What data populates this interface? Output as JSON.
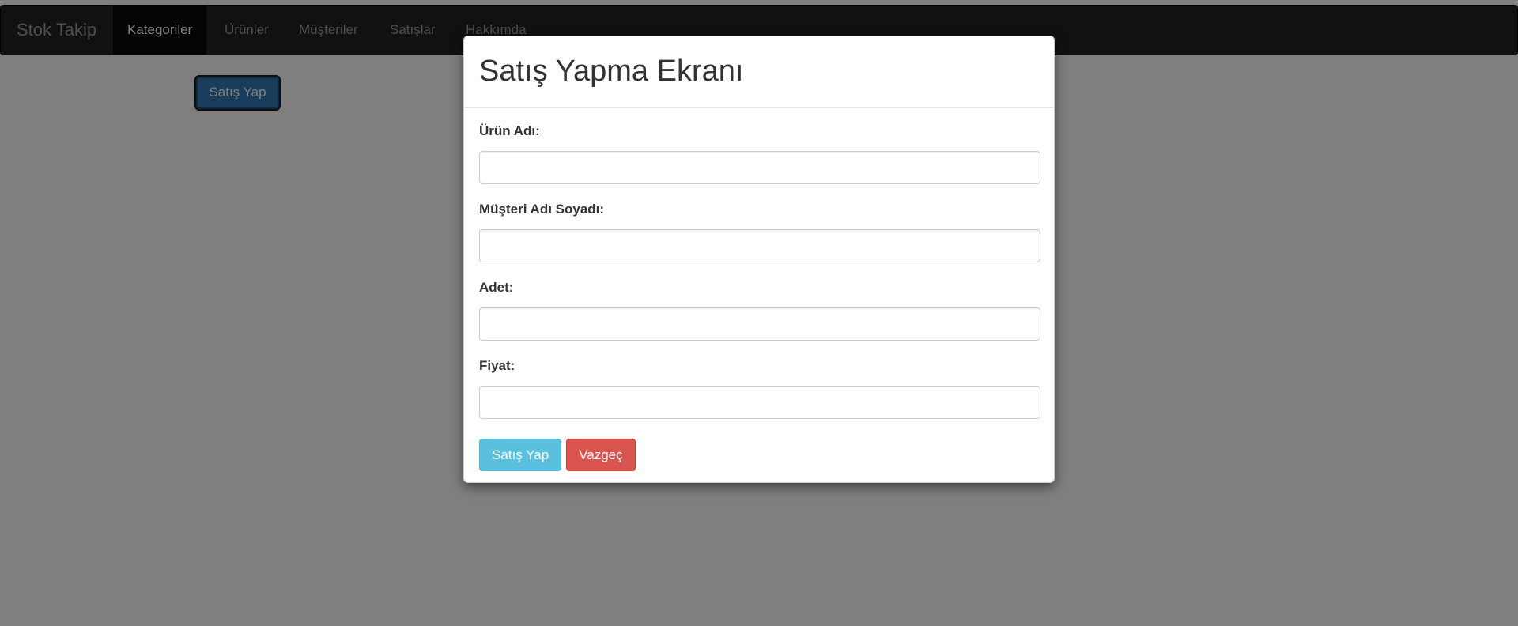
{
  "navbar": {
    "brand": "Stok Takip",
    "items": [
      {
        "label": "Kategoriler",
        "active": true
      },
      {
        "label": "Ürünler",
        "active": false
      },
      {
        "label": "Müşteriler",
        "active": false
      },
      {
        "label": "Satışlar",
        "active": false
      },
      {
        "label": "Hakkımda",
        "active": false
      }
    ]
  },
  "page": {
    "open_modal_button": "Satış Yap"
  },
  "modal": {
    "title": "Satış Yapma Ekranı",
    "fields": [
      {
        "label": "Ürün Adı:",
        "value": "",
        "placeholder": ""
      },
      {
        "label": "Müşteri Adı Soyadı:",
        "value": "",
        "placeholder": ""
      },
      {
        "label": "Adet:",
        "value": "",
        "placeholder": ""
      },
      {
        "label": "Fiyat:",
        "value": "",
        "placeholder": ""
      }
    ],
    "submit_label": "Satış Yap",
    "cancel_label": "Vazgeç"
  },
  "colors": {
    "navbar_bg": "#222222",
    "primary": "#337ab7",
    "info": "#5bc0de",
    "danger": "#d9534f",
    "backdrop": "rgba(0,0,0,0.5)"
  }
}
